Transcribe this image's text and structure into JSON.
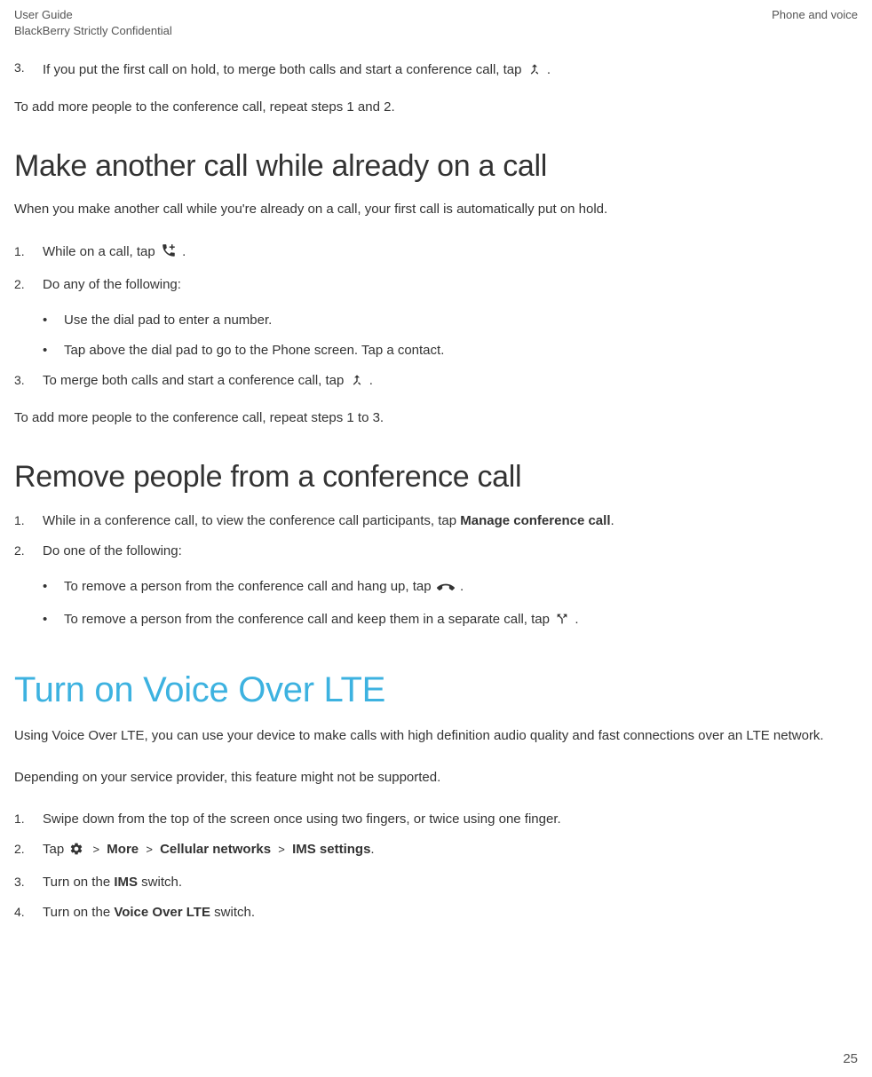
{
  "header": {
    "left_line1": "User Guide",
    "left_line2": "BlackBerry Strictly Confidential",
    "right": "Phone and voice"
  },
  "intro_step3": {
    "num": "3.",
    "text_before": "If you put the first call on hold, to merge both calls and start a conference call, tap ",
    "text_after": " ."
  },
  "intro_followup": "To add more people to the conference call, repeat steps 1 and 2.",
  "section1": {
    "heading": "Make another call while already on a call",
    "intro": "When you make another call while you're already on a call, your first call is automatically put on hold.",
    "steps": {
      "s1": {
        "num": "1.",
        "text_before": "While on a call, tap ",
        "text_after": "."
      },
      "s2": {
        "num": "2.",
        "text": "Do any of the following:"
      },
      "s3": {
        "num": "3.",
        "text_before": "To merge both calls and start a conference call, tap ",
        "text_after": " ."
      }
    },
    "bullets": {
      "b1": "Use the dial pad to enter a number.",
      "b2": "Tap above the dial pad to go to the Phone screen. Tap a contact."
    },
    "followup": "To add more people to the conference call, repeat steps 1 to 3."
  },
  "section2": {
    "heading": "Remove people from a conference call",
    "steps": {
      "s1": {
        "num": "1.",
        "text_before": "While in a conference call, to view the conference call participants, tap ",
        "bold": "Manage conference call",
        "text_after": "."
      },
      "s2": {
        "num": "2.",
        "text": "Do one of the following:"
      }
    },
    "bullets": {
      "b1": {
        "text_before": "To remove a person from the conference call and hang up, tap ",
        "text_after": " ."
      },
      "b2": {
        "text_before": "To remove a person from the conference call and keep them in a separate call, tap ",
        "text_after": " ."
      }
    }
  },
  "section3": {
    "heading": "Turn on Voice Over LTE",
    "intro1": "Using Voice Over LTE, you can use your device to make calls with high definition audio quality and fast connections over an LTE network.",
    "intro2": "Depending on your service provider, this feature might not be supported.",
    "steps": {
      "s1": {
        "num": "1.",
        "text": "Swipe down from the top of the screen once using two fingers, or twice using one finger."
      },
      "s2": {
        "num": "2.",
        "text_before": "Tap ",
        "gt": ">",
        "more": "More",
        "cellular": "Cellular networks",
        "ims": "IMS settings",
        "text_after": "."
      },
      "s3": {
        "num": "3.",
        "text_before": "Turn on the ",
        "bold": "IMS",
        "text_after": " switch."
      },
      "s4": {
        "num": "4.",
        "text_before": "Turn on the ",
        "bold": "Voice Over LTE",
        "text_after": " switch."
      }
    }
  },
  "page_number": "25"
}
